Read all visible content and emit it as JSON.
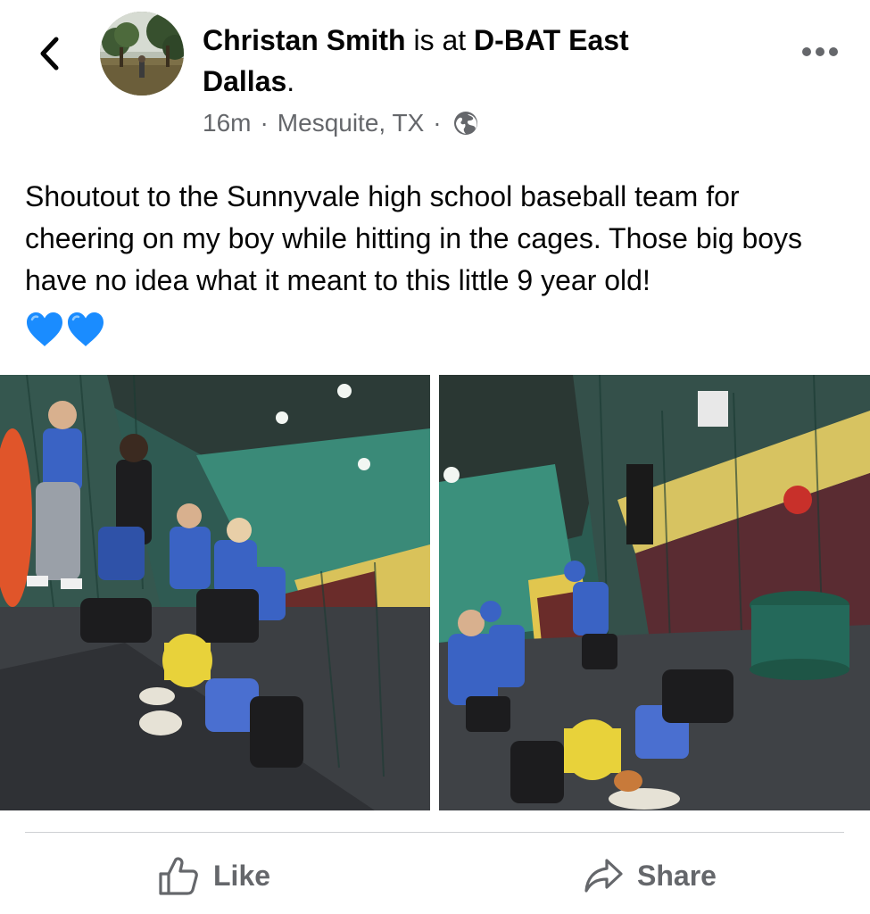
{
  "header": {
    "author_name": "Christan Smith",
    "checkin_text": " is at ",
    "place_name_line1": "D-BAT East",
    "place_name_line2": "Dallas",
    "period": ".",
    "time": "16m",
    "separator": "·",
    "location": "Mesquite, TX",
    "privacy_icon": "globe-icon",
    "back_icon": "chevron-left-icon",
    "more_icon": "more-horizontal-icon"
  },
  "post": {
    "text": "Shoutout to the Sunnyvale high school baseball team for cheering on my boy while hitting in the cages. Those big boys have no idea what it meant to this little 9 year old!",
    "hearts": [
      "💙",
      "💙"
    ],
    "heart_color": "#1a8cff"
  },
  "photos": [
    {
      "subject": "baseball team in batting cage"
    },
    {
      "subject": "baseball team gathered inside batting cage"
    }
  ],
  "actions": {
    "like_label": "Like",
    "share_label": "Share",
    "like_icon": "thumbs-up-icon",
    "share_icon": "share-arrow-icon"
  },
  "colors": {
    "text": "#050505",
    "secondary_text": "#65676b",
    "divider": "#ced0d4"
  }
}
